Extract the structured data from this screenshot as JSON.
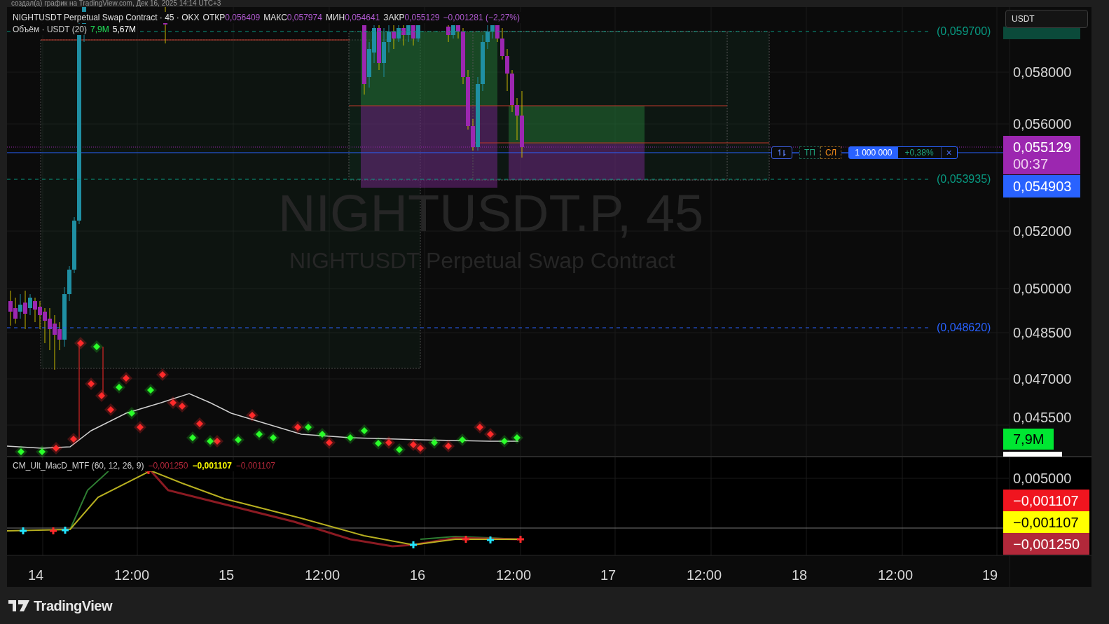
{
  "header": {
    "text": "создал(а) график на TradingView.com, Дек 16, 2025 14:14 UTC+3"
  },
  "legend": {
    "symbol": "NIGHTUSDT Perpetual Swap Contract · 45 · OKX",
    "ohlc": [
      {
        "label": "ОТКР",
        "value": "0,056409"
      },
      {
        "label": "МАКС",
        "value": "0,057974"
      },
      {
        "label": "МИН",
        "value": "0,054641"
      },
      {
        "label": "ЗАКР",
        "value": "0,055129"
      }
    ],
    "change": "−0,001281 (−2,27%)"
  },
  "volume_legend": {
    "title": "Объём · USDT (20)",
    "values": [
      {
        "text": "7,9M",
        "color": "#22e05a"
      },
      {
        "text": "5,67M",
        "color": "#ffffff"
      }
    ]
  },
  "watermark": {
    "symbol": "NIGHTUSDT.P, 45",
    "description": "NIGHTUSDT Perpetual Swap Contract"
  },
  "currency_button": "USDT",
  "price_axis": [
    "0,058000",
    "0,056000",
    "0,052000",
    "0,050000",
    "0,048500",
    "0,047000",
    "0,045500"
  ],
  "price_labels": [
    {
      "text": "0,055129",
      "sub": "00:37",
      "color": "#9c27b0"
    },
    {
      "text": "0,054903",
      "color": "#2962ff"
    },
    {
      "text": "7,9M",
      "color": "#00e632"
    }
  ],
  "level_lines": [
    {
      "text": "(0,059700)",
      "color": "#089981"
    },
    {
      "text": "(0,053935)",
      "color": "#089981"
    },
    {
      "text": "(0,048620)",
      "color": "#2962ff"
    }
  ],
  "order_bar": {
    "tp": "ТП",
    "sl": "СЛ",
    "quantity": "1 000 000",
    "pnl": "+0,38%",
    "close": "×"
  },
  "macd": {
    "title": "CM_Ult_MacD_MTF (60, 12, 26, 9)",
    "values": [
      {
        "text": "−0,001250",
        "color": "#b2283a"
      },
      {
        "text": "−0,001107",
        "color": "#ffff00"
      },
      {
        "text": "−0,001107",
        "color": "#b2283a"
      }
    ],
    "axis_tick": "0,005000",
    "labels": [
      {
        "text": "−0,001107",
        "color": "#f0151f"
      },
      {
        "text": "−0,001107",
        "color": "#ffff00"
      },
      {
        "text": "−0,001250",
        "color": "#b2283a"
      }
    ]
  },
  "time_axis": [
    "14",
    "12:00",
    "15",
    "12:00",
    "16",
    "12:00",
    "17",
    "12:00",
    "18",
    "12:00",
    "19"
  ],
  "footer": {
    "brand": "TradingView"
  }
}
